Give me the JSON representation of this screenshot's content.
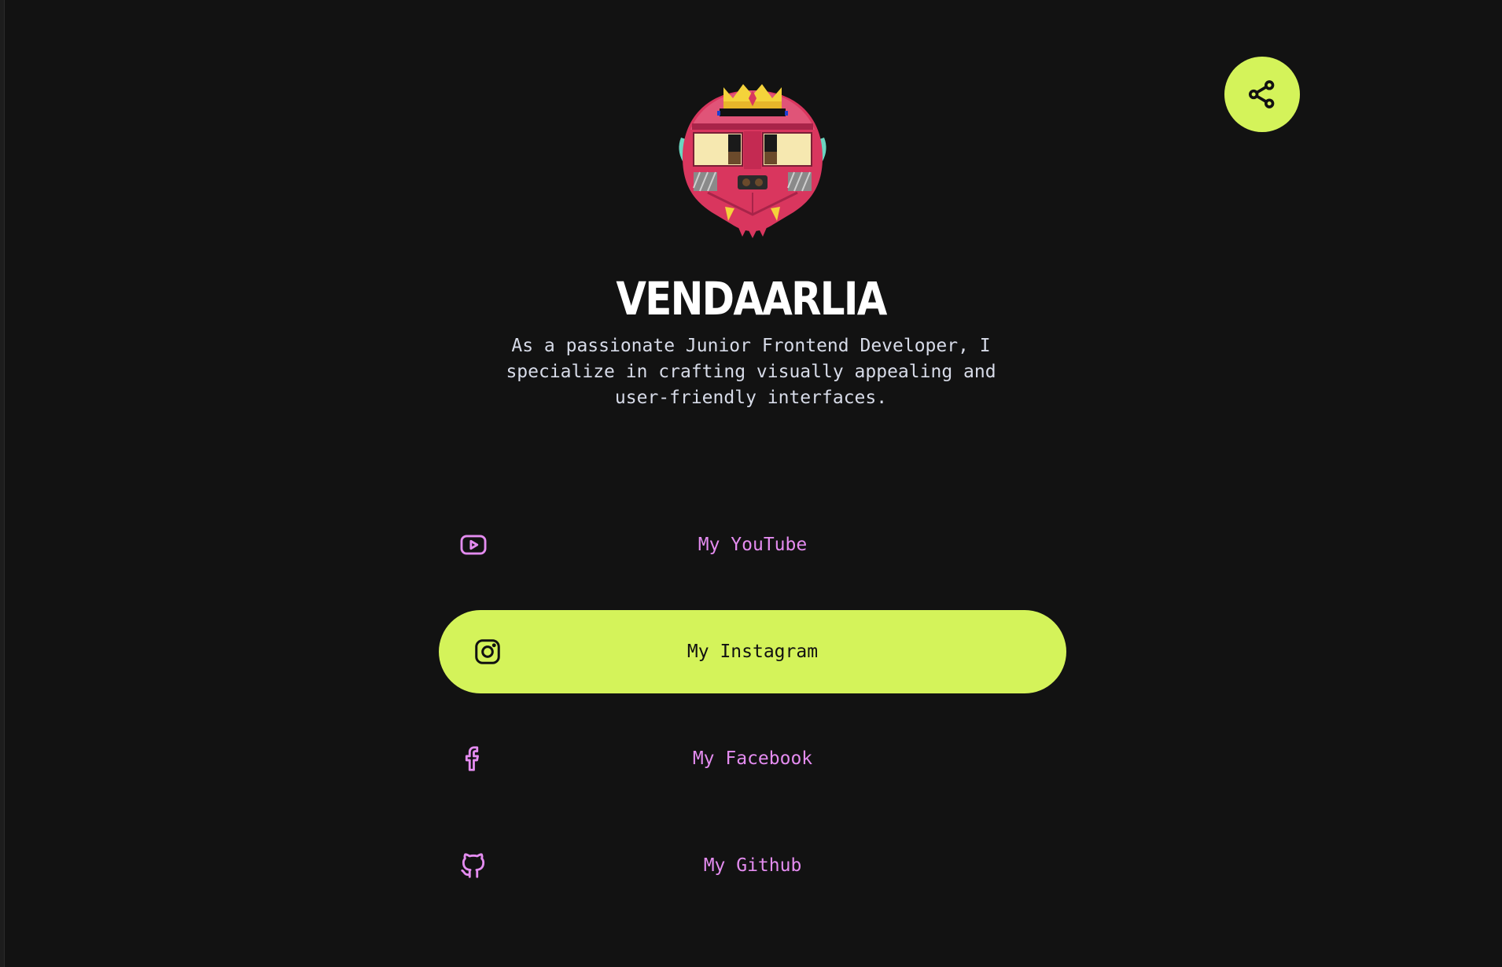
{
  "profile": {
    "name": "VENDAARLIA",
    "bio": "As a passionate Junior Frontend Developer, I specialize in crafting visually appealing and user-friendly interfaces."
  },
  "share": {
    "icon": "share-icon"
  },
  "links": [
    {
      "label": "My YouTube",
      "icon": "youtube-icon",
      "active": false
    },
    {
      "label": "My Instagram",
      "icon": "instagram-icon",
      "active": true
    },
    {
      "label": "My Facebook",
      "icon": "facebook-icon",
      "active": false
    },
    {
      "label": "My Github",
      "icon": "github-icon",
      "active": false
    }
  ],
  "colors": {
    "background": "#121212",
    "accent": "#d4f35a",
    "link_text": "#e48cf0",
    "name_text": "#ffffff",
    "bio_text": "#d7dbe8",
    "avatar_primary": "#d9365e",
    "avatar_crown": "#f4d33b"
  }
}
